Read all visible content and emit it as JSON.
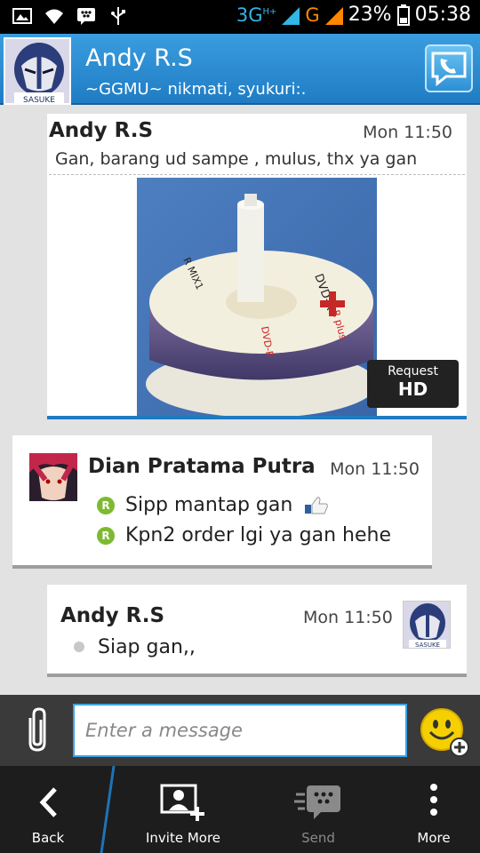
{
  "status_bar": {
    "network": "3G",
    "network_super": "H+",
    "network2": "G",
    "battery": "23%",
    "time": "05:38",
    "accent": "#33b5e5"
  },
  "header": {
    "contact_name": "Andy R.S",
    "contact_status": "~GGMU~ nikmati, syukuri:.",
    "avatar_label": "SASUKE",
    "accent": "#1f7cc4"
  },
  "messages": [
    {
      "sender": "Andy R.S",
      "time": "Mon 11:50",
      "text": "Gan, barang ud sampe , mulus, thx ya gan",
      "photo_labels": [
        "DVD-R",
        "R plus",
        "R MIX1",
        "DVD-R"
      ],
      "hd_button": {
        "top": "Request",
        "bottom": "HD"
      }
    },
    {
      "sender": "Dian Pratama Putra",
      "time": "Mon 11:50",
      "lines": [
        {
          "badge": "R",
          "text": "Sipp mantap gan"
        },
        {
          "badge": "R",
          "text": "Kpn2 order lgi ya gan hehe"
        }
      ]
    },
    {
      "sender": "Andy R.S",
      "time": "Mon 11:50",
      "text": "Siap gan,,",
      "avatar_label": "SASUKE"
    }
  ],
  "composer": {
    "placeholder": "Enter a message",
    "attach_icon": "paperclip-icon",
    "emoji_icon": "smiley-icon"
  },
  "action_bar": {
    "back": "Back",
    "invite": "Invite More",
    "send": "Send",
    "more": "More"
  }
}
